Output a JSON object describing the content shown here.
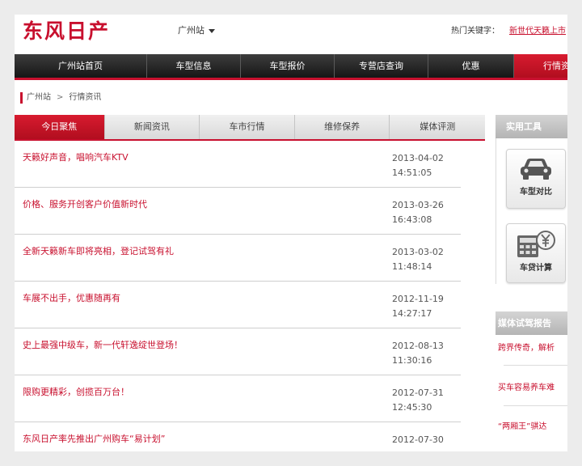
{
  "header": {
    "logo_text": "东风日产",
    "city_label": "广州站",
    "hot_keywords_label": "热门关键字：",
    "hot_keyword_link": "新世代天籁上市"
  },
  "nav": {
    "items": [
      "广州站首页",
      "车型信息",
      "车型报价",
      "专营店查询",
      "优惠",
      "行情资讯"
    ],
    "active_index": 5
  },
  "breadcrumb": {
    "home": "广州站",
    "separator": ">",
    "current": "行情资讯"
  },
  "tabs": {
    "items": [
      "今日聚焦",
      "新闻资讯",
      "车市行情",
      "维修保养",
      "媒体评测"
    ],
    "active_index": 0
  },
  "news": [
    {
      "title": "天籁好声音，唱响汽车KTV",
      "date": "2013-04-02",
      "time": "14:51:05"
    },
    {
      "title": "价格、服务开创客户价值新时代",
      "date": "2013-03-26",
      "time": "16:43:08"
    },
    {
      "title": "全新天籁新车即将亮相，登记试驾有礼",
      "date": "2013-03-02",
      "time": "11:48:14"
    },
    {
      "title": "车展不出手，优惠随再有",
      "date": "2012-11-19",
      "time": "14:27:17"
    },
    {
      "title": "史上最强中级车，新一代轩逸绽世登场！",
      "date": "2012-08-13",
      "time": "11:30:16"
    },
    {
      "title": "限购更精彩，创揽百万台！",
      "date": "2012-07-31",
      "time": "12:45:30"
    },
    {
      "title": "东风日产率先推出广州购车“易计划”",
      "date": "2012-07-30",
      "time": ""
    }
  ],
  "tools": {
    "title": "实用工具",
    "items": [
      {
        "label": "车型对比",
        "icon": "car-icon"
      },
      {
        "label": "车贷计算",
        "icon": "calculator-yen-icon"
      }
    ]
  },
  "media": {
    "title": "媒体试驾报告",
    "items": [
      "跨界传奇，解析",
      "买车容易养车难",
      "“两厢王”骐达"
    ]
  },
  "colors": {
    "brand_red": "#c8102e",
    "nav_dark": "#1f1f1f"
  }
}
